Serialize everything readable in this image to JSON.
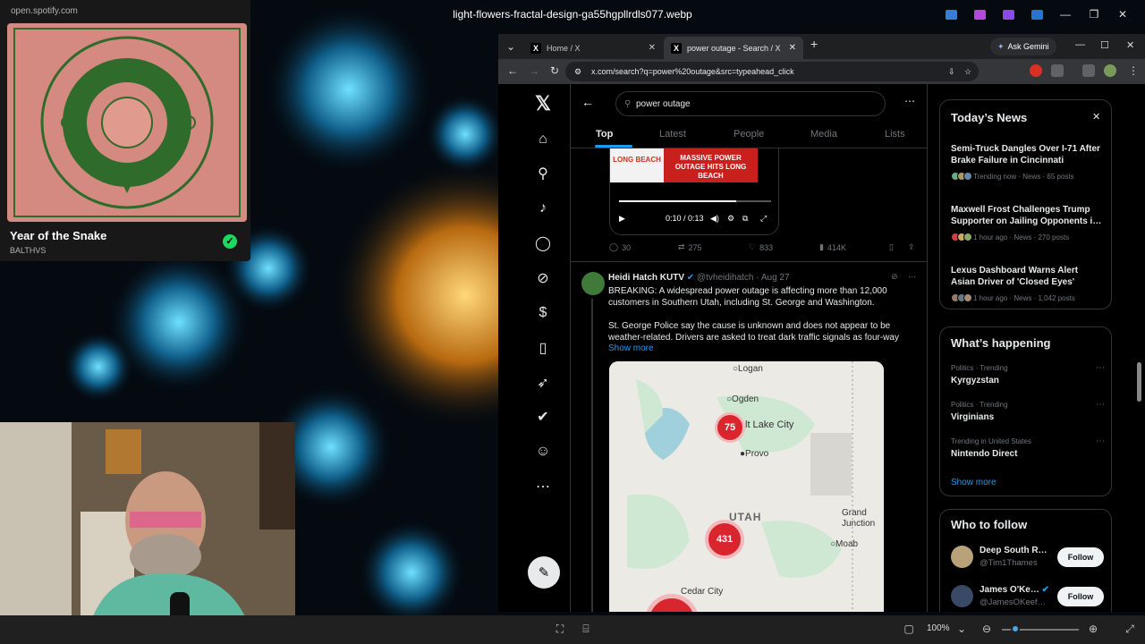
{
  "viewer": {
    "title": "light-flowers-fractal-design-ga55hgpllrdls077.webp",
    "zoom": "100%"
  },
  "spotify": {
    "url": "open.spotify.com",
    "song": "Year of the Snake",
    "artist": "BALTHVS",
    "check": "✓"
  },
  "chrome": {
    "tabs": [
      {
        "label": "Home / X"
      },
      {
        "label": "power outage - Search / X"
      }
    ],
    "gemini": "Ask Gemini",
    "url": "x.com/search?q=power%20outage&src=typeahead_click"
  },
  "x": {
    "search_value": "power outage",
    "tabs": [
      "Top",
      "Latest",
      "People",
      "Media",
      "Lists"
    ],
    "video": {
      "thumb_left": "LONG BEACH",
      "thumb_right": "MASSIVE POWER OUTAGE HITS LONG BEACH",
      "time": "0:10 / 0:13",
      "replies": "30",
      "reposts": "275",
      "likes": "833",
      "views": "414K"
    },
    "tweet": {
      "name": "Heidi Hatch KUTV",
      "handle": "@tvheidihatch",
      "date": "· Aug 27",
      "para1": "BREAKING: A widespread power outage is affecting more than 12,000 customers in Southern Utah, including St. George and Washington.",
      "para2": "St. George Police say the cause is unknown and does not appear to be weather-related. Drivers are asked to treat dark traffic signals as four-way",
      "show_more": "Show more",
      "map": {
        "logan": "Logan",
        "ogden": "Ogden",
        "slc": "lt Lake City",
        "provo": "Provo",
        "utah": "UTAH",
        "grand": "Grand",
        "junction": "Junction",
        "moab": "Moab",
        "cedar": "Cedar City",
        "c75": "75",
        "c431": "431"
      }
    },
    "news": {
      "title": "Today’s News",
      "items": [
        {
          "headline": "Semi-Truck Dangles Over I-71 After Brake Failure in Cincinnati",
          "meta": "Trending now · News · 65 posts"
        },
        {
          "headline": "Maxwell Frost Challenges Trump Supporter on Jailing Opponents i…",
          "meta": "1 hour ago · News · 270 posts"
        },
        {
          "headline": "Lexus Dashboard Warns Alert Asian Driver of 'Closed Eyes'",
          "meta": "1 hour ago · News · 1,042 posts"
        }
      ]
    },
    "happening": {
      "title": "What’s happening",
      "items": [
        {
          "context": "Politics · Trending",
          "name": "Kyrgyzstan"
        },
        {
          "context": "Politics · Trending",
          "name": "Virginians"
        },
        {
          "context": "Trending in United States",
          "name": "Nintendo Direct"
        }
      ],
      "show_more": "Show more"
    },
    "follow": {
      "title": "Who to follow",
      "button": "Follow",
      "users": [
        {
          "name": "Deep South R…",
          "handle": "@Tim1Thames"
        },
        {
          "name": "James O'Ke…",
          "handle": "@JamesOKeef…"
        }
      ]
    }
  }
}
